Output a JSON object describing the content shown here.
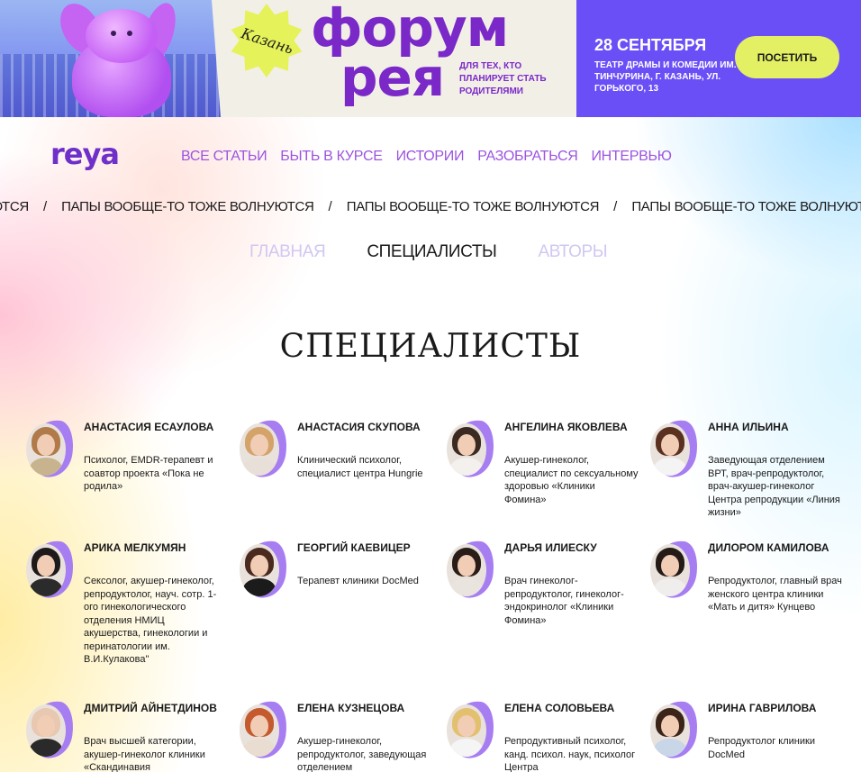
{
  "banner": {
    "city": "Казань",
    "title_line1": "форум",
    "title_line2": "рея",
    "subtitle": "ДЛЯ ТЕХ, КТО ПЛАНИРУЕТ СТАТЬ РОДИТЕЛЯМИ",
    "date": "28 СЕНТЯБРЯ",
    "venue": "ТЕАТР ДРАМЫ И КОМЕДИИ ИМ. ТИНЧУРИНА, Г. КАЗАНЬ, УЛ. ГОРЬКОГО, 13",
    "cta_label": "ПОСЕТИТЬ",
    "colors": {
      "primary": "#6b4ff6",
      "accent": "#e3f063",
      "brand": "#7a28c8"
    }
  },
  "header": {
    "logo": "reya",
    "nav": [
      "ВСЕ СТАТЬИ",
      "БЫТЬ В КУРСЕ",
      "ИСТОРИИ",
      "РАЗОБРАТЬСЯ",
      "ИНТЕРВЬЮ"
    ]
  },
  "ticker": {
    "items": [
      "ЮТСЯ",
      "ПАПЫ ВООБЩЕ-ТО ТОЖЕ ВОЛНУЮТСЯ",
      "ПАПЫ ВООБЩЕ-ТО ТОЖЕ ВОЛНУЮТСЯ",
      "ПАПЫ ВООБЩЕ-ТО ТОЖЕ ВОЛНУЮТСЯ"
    ],
    "separator": "/"
  },
  "tabs": [
    "ГЛАВНАЯ",
    "СПЕЦИАЛИСТЫ",
    "АВТОРЫ"
  ],
  "page_title": "СПЕЦИАЛИСТЫ",
  "specialists": [
    {
      "name": "АНАСТАСИЯ ЕСАУЛОВА",
      "desc": "Психолог, EMDR-терапевт и соавтор проекта «Пока не родила»"
    },
    {
      "name": "АНАСТАСИЯ СКУПОВА",
      "desc": "Клинический психолог, специалист центра Hungrie"
    },
    {
      "name": "АНГЕЛИНА ЯКОВЛЕВА",
      "desc": "Акушер-гинеколог, специалист по сексуальному здоровью «Клиники Фомина»"
    },
    {
      "name": "АННА ИЛЬИНА",
      "desc": "Заведующая отделением ВРТ, врач-репродуктолог, врач-акушер-гинеколог Центра репродукции «Линия жизни»"
    },
    {
      "name": "АРИКА МЕЛКУМЯН",
      "desc": "Сексолог, акушер-гинеколог, репродуктолог, науч. сотр. 1-ого гинекологического отделения НМИЦ акушерства, гинекологии и перинатологии им. В.И.Кулакова\""
    },
    {
      "name": "ГЕОРГИЙ КАЕВИЦЕР",
      "desc": "Терапевт клиники DocMed"
    },
    {
      "name": "ДАРЬЯ ИЛИЕСКУ",
      "desc": "Врач гинеколог-репродуктолог, гинеколог-эндокринолог «Клиники Фомина»"
    },
    {
      "name": "ДИЛОРОМ КАМИЛОВА",
      "desc": "Репродуктолог, главный врач женского центра клиники «Мать и дитя» Кунцево"
    },
    {
      "name": "ДМИТРИЙ АЙНЕТДИНОВ",
      "desc": "Врач высшей категории, акушер-гинеколог клиники «Скандинавия"
    },
    {
      "name": "ЕЛЕНА КУЗНЕЦОВА",
      "desc": "Акушер-гинеколог, репродуктолог, заведующая отделением"
    },
    {
      "name": "ЕЛЕНА СОЛОВЬЕВА",
      "desc": "Репродуктивный психолог, канд. психол. наук, психолог Центра"
    },
    {
      "name": "ИРИНА ГАВРИЛОВА",
      "desc": "Репродуктолог клиники DocMed"
    }
  ]
}
